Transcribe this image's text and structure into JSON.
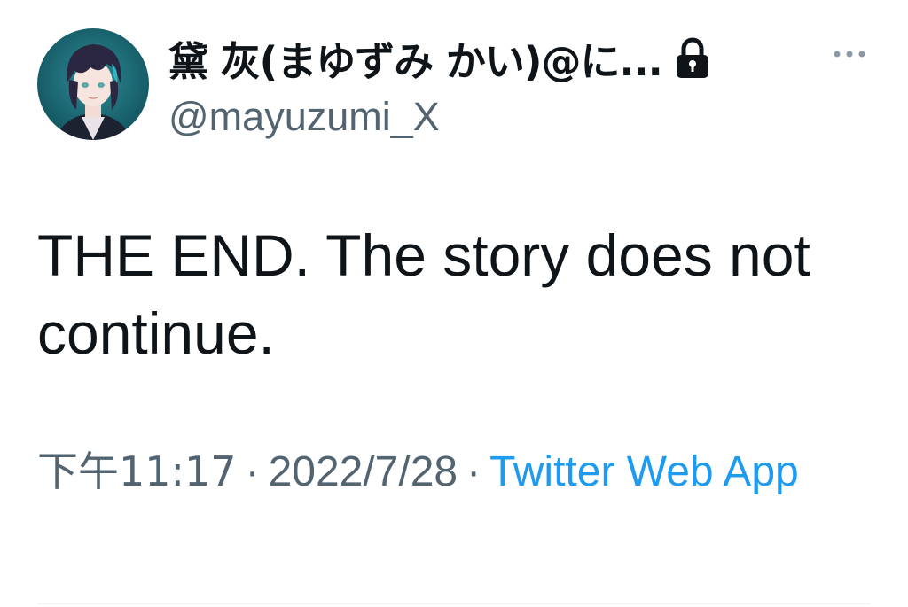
{
  "user": {
    "display_name": "黛 灰(まゆずみ かい)@に...",
    "handle": "@mayuzumi_X",
    "protected_icon": "lock-icon",
    "avatar_icon": "avatar-image"
  },
  "header": {
    "more_icon": "more-horizontal-icon"
  },
  "tweet": {
    "text": "THE END. The story does not continue."
  },
  "meta": {
    "time": "下午11:17",
    "separator": "·",
    "date": "2022/7/28",
    "source": "Twitter Web App"
  },
  "colors": {
    "text_primary": "#0f1419",
    "text_secondary": "#536471",
    "link": "#1d9bf0",
    "divider": "#eff3f4"
  }
}
